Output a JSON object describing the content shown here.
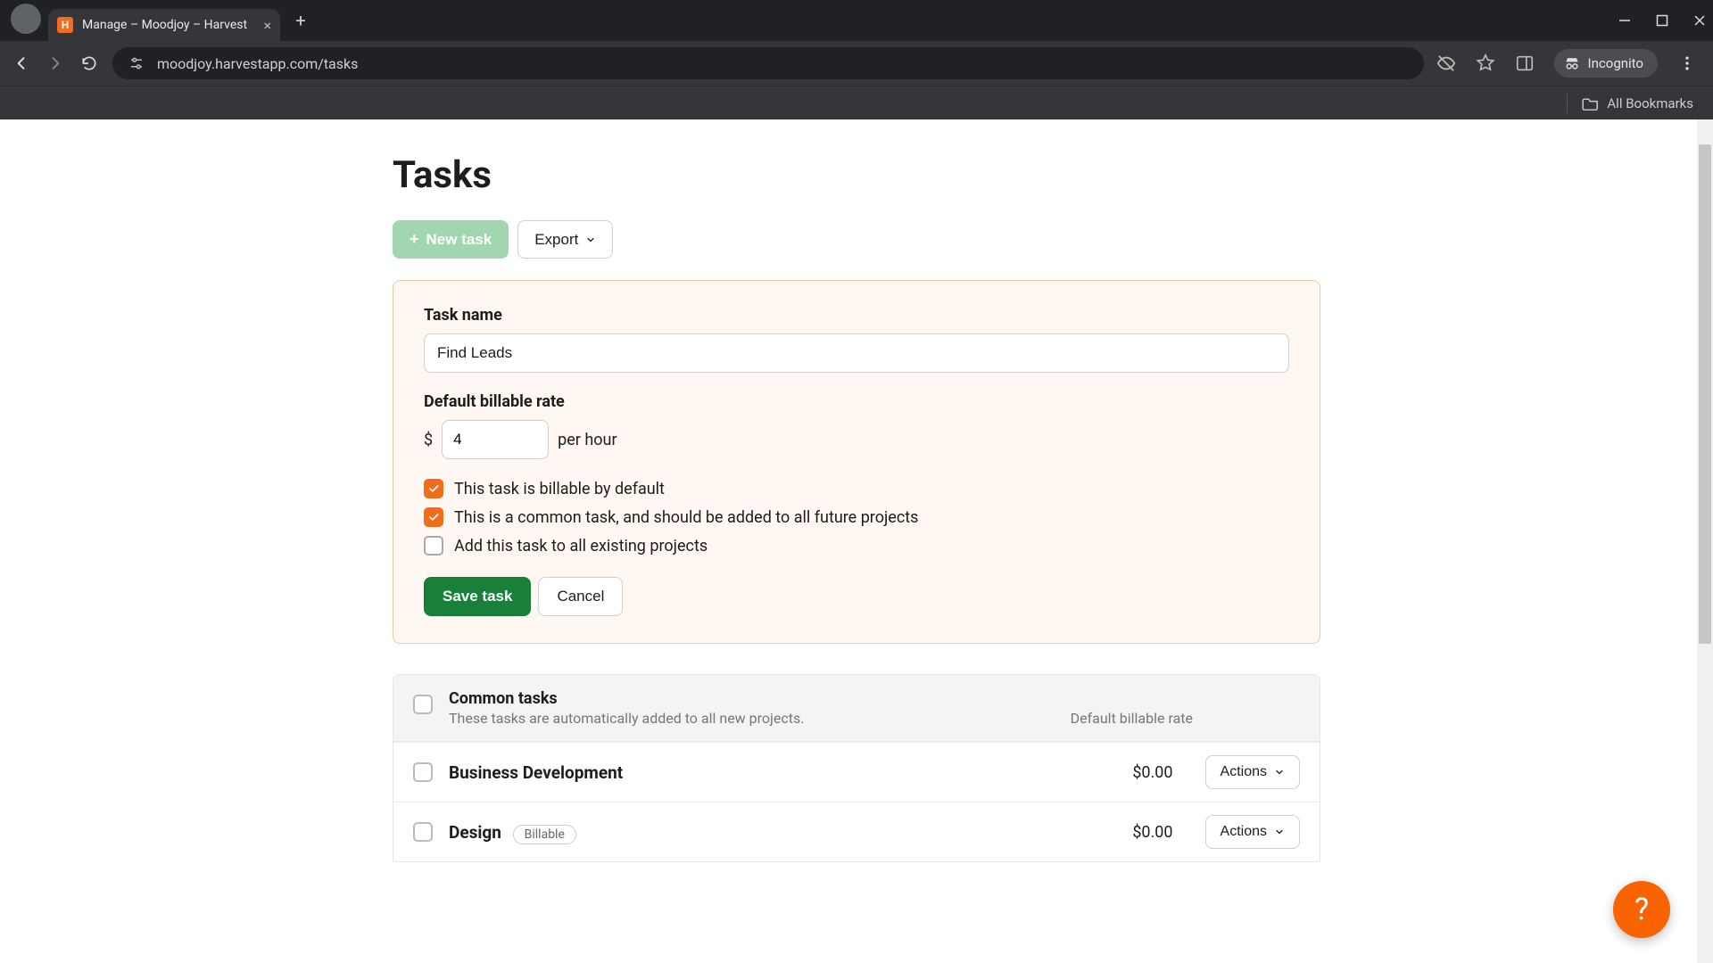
{
  "browser": {
    "tab_title": "Manage – Moodjoy – Harvest",
    "url": "moodjoy.harvestapp.com/tasks",
    "incognito_label": "Incognito",
    "all_bookmarks_label": "All Bookmarks"
  },
  "page": {
    "title": "Tasks"
  },
  "toolbar": {
    "new_task_label": "New task",
    "export_label": "Export"
  },
  "form": {
    "task_name_label": "Task name",
    "task_name_value": "Find Leads",
    "rate_label": "Default billable rate",
    "currency_symbol": "$",
    "rate_value": "4",
    "rate_suffix": "per hour",
    "checkboxes": {
      "billable_label": "This task is billable by default",
      "billable_checked": true,
      "common_label": "This is a common task, and should be added to all future projects",
      "common_checked": true,
      "add_existing_label": "Add this task to all existing projects",
      "add_existing_checked": false
    },
    "save_label": "Save task",
    "cancel_label": "Cancel"
  },
  "table": {
    "header_title": "Common tasks",
    "header_sub": "These tasks are automatically added to all new projects.",
    "header_rate_col": "Default billable rate",
    "actions_label": "Actions",
    "rows": [
      {
        "name": "Business Development",
        "billable_badge": "",
        "rate": "$0.00"
      },
      {
        "name": "Design",
        "billable_badge": "Billable",
        "rate": "$0.00"
      }
    ]
  },
  "help": {
    "label": "?"
  },
  "colors": {
    "accent_orange": "#f36c1b",
    "save_green": "#188038",
    "new_task_green": "#a2d6b1"
  }
}
